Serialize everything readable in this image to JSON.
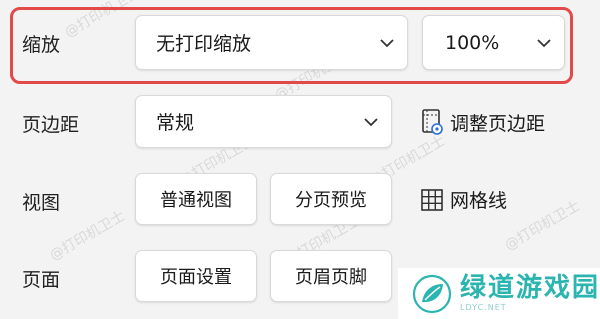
{
  "watermark": "@打印机卫士",
  "rows": {
    "zoom": {
      "label": "缩放",
      "scaling_select": "无打印缩放",
      "percent_select": "100%"
    },
    "margins": {
      "label": "页边距",
      "select": "常规",
      "adjust_button": "调整页边距"
    },
    "view": {
      "label": "视图",
      "normal_button": "普通视图",
      "pagebreak_button": "分页预览",
      "gridlines_button": "网格线"
    },
    "page": {
      "label": "页面",
      "setup_button": "页面设置",
      "header_footer_button": "页眉页脚"
    }
  },
  "logo": {
    "text": "绿道游戏园",
    "subtext": "LDYC.NET"
  },
  "colors": {
    "highlight": "#e24a4a",
    "logo": "#2bb5b0"
  }
}
